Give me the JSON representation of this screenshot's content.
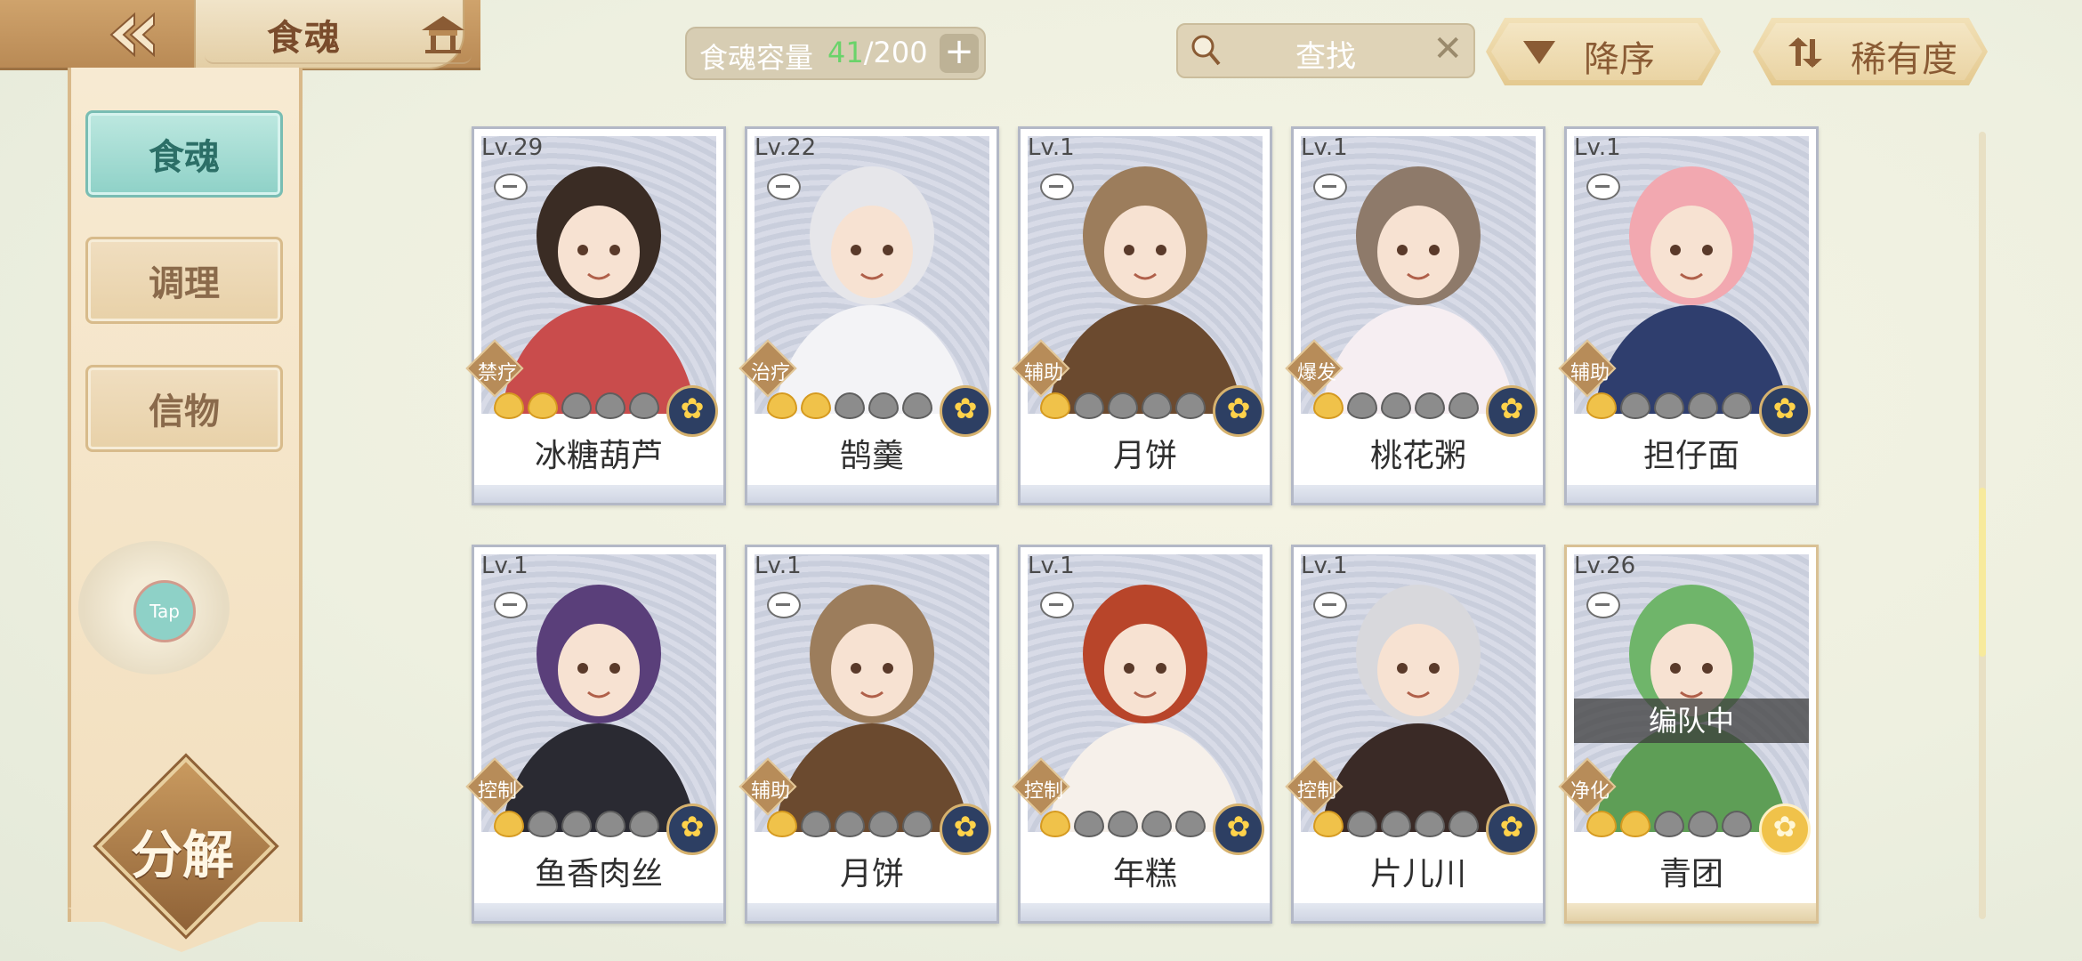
{
  "header": {
    "title": "食魂",
    "capacity": {
      "label": "食魂容量",
      "current": "41",
      "max": "/200",
      "add": "+"
    },
    "search": {
      "placeholder": "查找",
      "clear": "✕"
    },
    "sort_desc": "降序",
    "sort_rarity": "稀有度"
  },
  "sidebar": {
    "tabs": [
      {
        "label": "食魂",
        "active": true
      },
      {
        "label": "调理",
        "active": false
      },
      {
        "label": "信物",
        "active": false
      }
    ],
    "tap": "Tap",
    "decompose": "分解"
  },
  "cards": [
    {
      "level": "Lv.29",
      "role": "禁疗",
      "name": "冰糖葫芦",
      "stars_on": 2,
      "stars_total": 5,
      "rarity": "blue"
    },
    {
      "level": "Lv.22",
      "role": "治疗",
      "name": "鹄羹",
      "stars_on": 2,
      "stars_total": 5,
      "rarity": "blue"
    },
    {
      "level": "Lv.1",
      "role": "辅助",
      "name": "月饼",
      "stars_on": 1,
      "stars_total": 5,
      "rarity": "blue"
    },
    {
      "level": "Lv.1",
      "role": "爆发",
      "name": "桃花粥",
      "stars_on": 1,
      "stars_total": 5,
      "rarity": "blue"
    },
    {
      "level": "Lv.1",
      "role": "辅助",
      "name": "担仔面",
      "stars_on": 1,
      "stars_total": 5,
      "rarity": "blue"
    },
    {
      "level": "Lv.1",
      "role": "控制",
      "name": "鱼香肉丝",
      "stars_on": 1,
      "stars_total": 5,
      "rarity": "blue"
    },
    {
      "level": "Lv.1",
      "role": "辅助",
      "name": "月饼",
      "stars_on": 1,
      "stars_total": 5,
      "rarity": "blue"
    },
    {
      "level": "Lv.1",
      "role": "控制",
      "name": "年糕",
      "stars_on": 1,
      "stars_total": 5,
      "rarity": "blue"
    },
    {
      "level": "Lv.1",
      "role": "控制",
      "name": "片儿川",
      "stars_on": 1,
      "stars_total": 5,
      "rarity": "blue"
    },
    {
      "level": "Lv.26",
      "role": "净化",
      "name": "青团",
      "stars_on": 2,
      "stars_total": 5,
      "rarity": "gold",
      "banner": "编队中"
    }
  ],
  "colors": {
    "accent_teal": "#8ed1c7",
    "gold": "#f0c24a",
    "brown": "#8a5b34"
  }
}
